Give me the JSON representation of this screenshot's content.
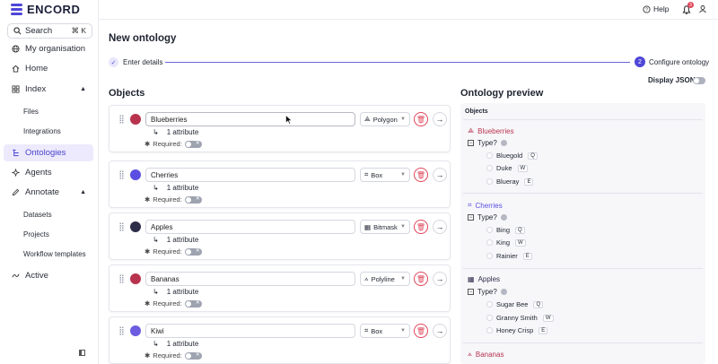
{
  "brand": {
    "name": "ENCORD",
    "accent": "#4f46d8"
  },
  "search": {
    "label": "Search",
    "shortcut": "⌘ K"
  },
  "sidebar": {
    "items": [
      {
        "label": "My organisation",
        "icon": "globe-icon"
      },
      {
        "label": "Home",
        "icon": "home-icon"
      },
      {
        "label": "Index",
        "icon": "grid-icon"
      },
      {
        "label": "Files"
      },
      {
        "label": "Integrations"
      },
      {
        "label": "Ontologies",
        "icon": "ontology-icon"
      },
      {
        "label": "Agents",
        "icon": "agents-icon"
      },
      {
        "label": "Annotate",
        "icon": "annotate-icon"
      },
      {
        "label": "Datasets"
      },
      {
        "label": "Projects"
      },
      {
        "label": "Workflow templates"
      },
      {
        "label": "Active",
        "icon": "active-icon"
      }
    ]
  },
  "topbar": {
    "help": "Help",
    "notifications": "3"
  },
  "page": {
    "title": "New ontology",
    "step1": "Enter details",
    "step2_num": "2",
    "step2": "Configure ontology",
    "display_json": "Display JSON",
    "objects_heading": "Objects",
    "preview_heading": "Ontology preview"
  },
  "objects": [
    {
      "name": "Blueberries",
      "color": "#b8334d",
      "shape": "Polygon",
      "attribute": "1 attribute",
      "required": "Required:"
    },
    {
      "name": "Cherries",
      "color": "#5a4fe0",
      "shape": "Box",
      "attribute": "1 attribute",
      "required": "Required:"
    },
    {
      "name": "Apples",
      "color": "#2d2d4a",
      "shape": "Bitmask",
      "attribute": "1 attribute",
      "required": "Required:"
    },
    {
      "name": "Bananas",
      "color": "#b8334d",
      "shape": "Polyline",
      "attribute": "1 attribute",
      "required": "Required:"
    },
    {
      "name": "Kiwi",
      "color": "#6b5ce0",
      "shape": "Box",
      "attribute": "1 attribute",
      "required": "Required:"
    }
  ],
  "preview": {
    "objects_label": "Objects",
    "classes": [
      {
        "name": "Blueberries",
        "color": "#b8334d",
        "question": "Type?",
        "options": [
          {
            "label": "Bluegold",
            "key": "Q"
          },
          {
            "label": "Duke",
            "key": "W"
          },
          {
            "label": "Blueray",
            "key": "E"
          }
        ]
      },
      {
        "name": "Cherries",
        "color": "#5a4fe0",
        "question": "Type?",
        "options": [
          {
            "label": "Bing",
            "key": "Q"
          },
          {
            "label": "King",
            "key": "W"
          },
          {
            "label": "Rainier",
            "key": "E"
          }
        ]
      },
      {
        "name": "Apples",
        "color": "#2d2d4a",
        "question": "Type?",
        "options": [
          {
            "label": "Sugar Bee",
            "key": "Q"
          },
          {
            "label": "Granny Smith",
            "key": "W"
          },
          {
            "label": "Honey Crisp",
            "key": "E"
          }
        ]
      },
      {
        "name": "Bananas",
        "color": "#b8334d"
      }
    ]
  }
}
